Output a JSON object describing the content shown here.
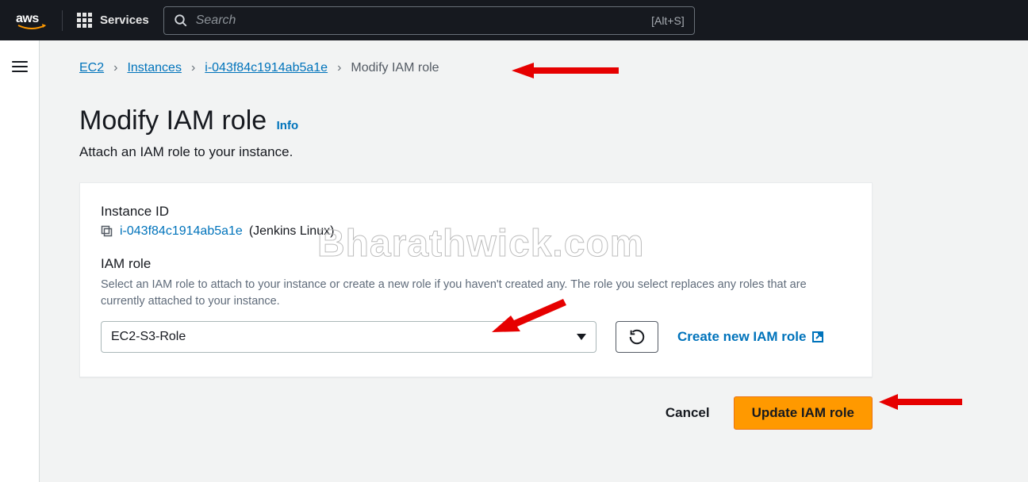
{
  "nav": {
    "services_label": "Services",
    "search_placeholder": "Search",
    "search_shortcut": "[Alt+S]"
  },
  "breadcrumbs": {
    "items": [
      "EC2",
      "Instances",
      "i-043f84c1914ab5a1e"
    ],
    "current": "Modify IAM role"
  },
  "page": {
    "title": "Modify IAM role",
    "info_label": "Info",
    "subtitle": "Attach an IAM role to your instance."
  },
  "panel": {
    "instance_id_label": "Instance ID",
    "instance_id": "i-043f84c1914ab5a1e",
    "instance_name": "(Jenkins Linux)",
    "iam_role_label": "IAM role",
    "iam_role_help": "Select an IAM role to attach to your instance or create a new role if you haven't created any. The role you select replaces any roles that are currently attached to your instance.",
    "iam_role_selected": "EC2-S3-Role",
    "create_link": "Create new IAM role"
  },
  "footer": {
    "cancel": "Cancel",
    "submit": "Update IAM role"
  },
  "watermark": "Bharathwick.com"
}
